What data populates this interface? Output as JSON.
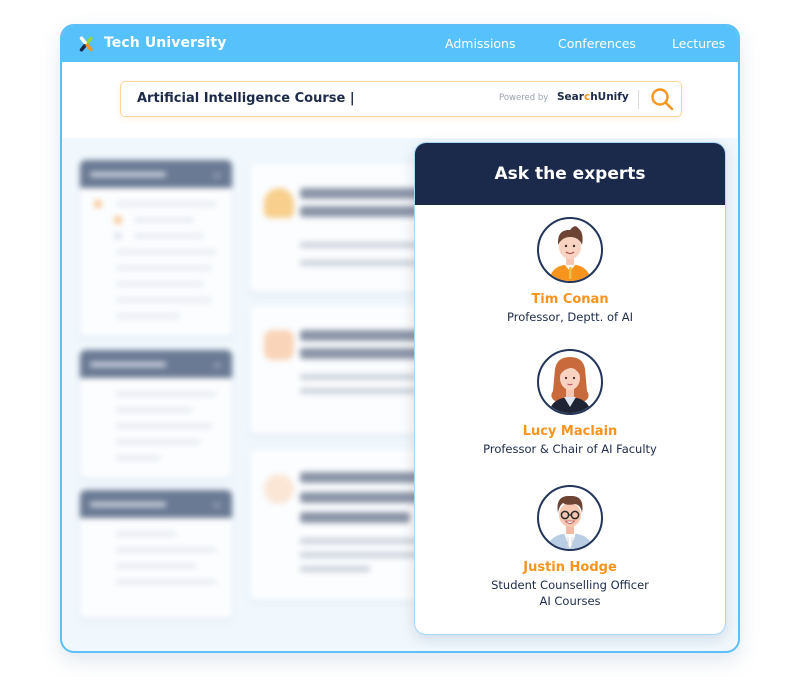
{
  "header": {
    "brand": "Tech University",
    "logo_icon": "tech-university-logo-icon",
    "nav": [
      {
        "label": "Admissions"
      },
      {
        "label": "Conferences"
      },
      {
        "label": "Lectures"
      }
    ],
    "colors": {
      "topbar": "#56c1fb",
      "accent": "#f7941d",
      "navy": "#1b2a4b"
    }
  },
  "search": {
    "value": "Artificial Intelligence Course |",
    "powered_by": "Powered by",
    "provider_prefix": "Sear",
    "provider_o": "c",
    "provider_suffix": "hUnify",
    "button_icon": "search-icon"
  },
  "experts_panel": {
    "title": "Ask the experts",
    "experts": [
      {
        "name": "Tim Conan",
        "role": "Professor, Deptt. of AI",
        "role2": ""
      },
      {
        "name": "Lucy Maclain",
        "role": "Professor & Chair of AI Faculty",
        "role2": ""
      },
      {
        "name": "Justin Hodge",
        "role": "Student Counselling Officer",
        "role2": "AI Courses"
      }
    ]
  }
}
